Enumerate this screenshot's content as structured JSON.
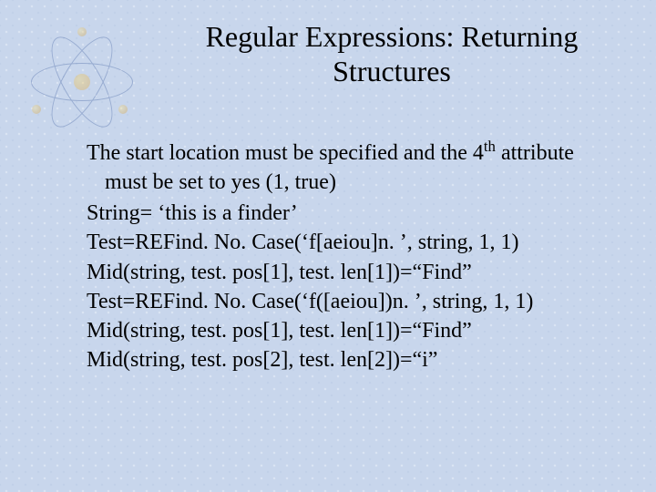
{
  "title_line1": "Regular Expressions: Returning",
  "title_line2": "Structures",
  "intro_line1": "The start location must be specified and the 4",
  "intro_sup": "th",
  "intro_after_sup": " attribute",
  "intro_line2": "must be set to yes (1, true)",
  "lines": [
    "String= ‘this is a finder’",
    "Test=REFind. No. Case(‘f[aeiou]n. ’, string, 1, 1)",
    "Mid(string, test. pos[1], test. len[1])=“Find”",
    "Test=REFind. No. Case(‘f([aeiou])n. ’, string, 1, 1)",
    "Mid(string, test. pos[1], test. len[1])=“Find”",
    "Mid(string, test. pos[2], test. len[2])=“i”"
  ]
}
